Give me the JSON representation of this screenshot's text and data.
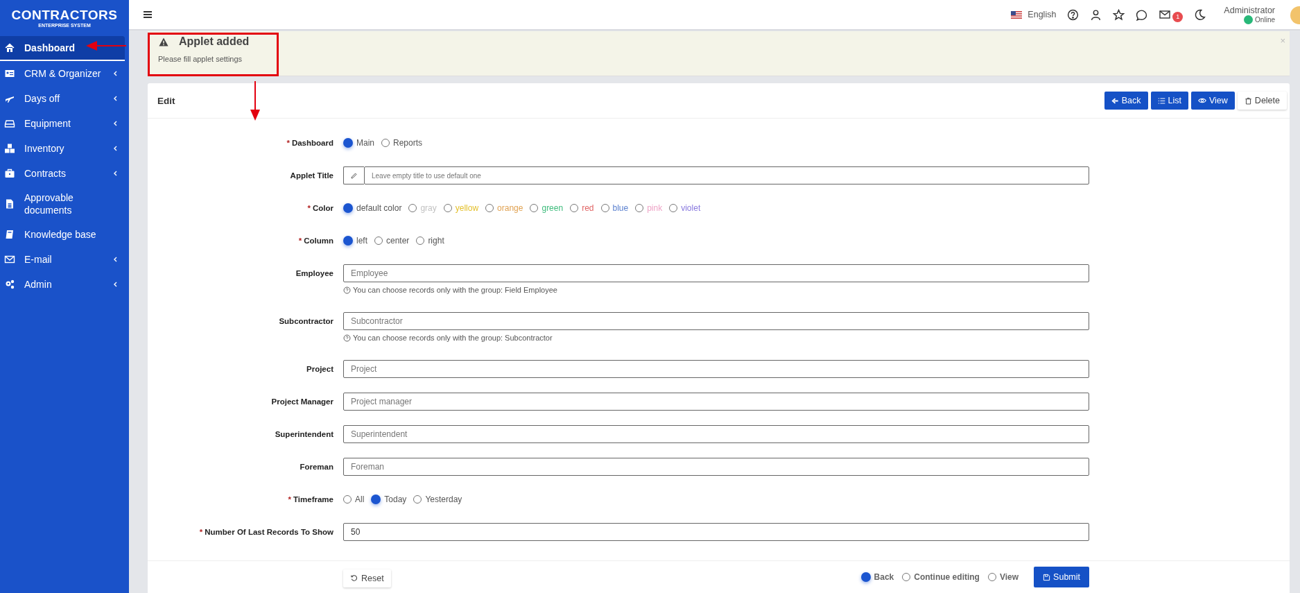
{
  "sidebar": {
    "logo": {
      "title": "CONTRACTORS",
      "subtitle": "ENTERPRISE SYSTEM"
    },
    "items": [
      {
        "label": "Dashboard",
        "selected": true,
        "submenu": false
      },
      {
        "label": "CRM & Organizer",
        "selected": false,
        "submenu": true
      },
      {
        "label": "Days off",
        "selected": false,
        "submenu": true
      },
      {
        "label": "Equipment",
        "selected": false,
        "submenu": true
      },
      {
        "label": "Inventory",
        "selected": false,
        "submenu": true
      },
      {
        "label": "Contracts",
        "selected": false,
        "submenu": true
      },
      {
        "label": "Approvable documents",
        "selected": false,
        "submenu": false
      },
      {
        "label": "Knowledge base",
        "selected": false,
        "submenu": false
      },
      {
        "label": "E-mail",
        "selected": false,
        "submenu": true
      },
      {
        "label": "Admin",
        "selected": false,
        "submenu": true
      }
    ]
  },
  "header": {
    "language": "English",
    "mail_badge": "1",
    "user": {
      "name": "Administrator",
      "status": "Online"
    }
  },
  "alert": {
    "title": "Applet added",
    "message": "Please fill applet settings",
    "close": "×"
  },
  "card": {
    "title": "Edit",
    "actions": [
      {
        "label": "Back",
        "kind": "primary"
      },
      {
        "label": "List",
        "kind": "primary"
      },
      {
        "label": "View",
        "kind": "primary"
      },
      {
        "label": "Delete",
        "kind": "light"
      }
    ],
    "fields": [
      {
        "label": "Dashboard",
        "marker": "*",
        "kind": "radio",
        "options": [
          {
            "label": "Main",
            "selected": true
          },
          {
            "label": "Reports",
            "selected": false
          }
        ]
      },
      {
        "label": "Applet Title",
        "kind": "input",
        "prefix_icon": true,
        "placeholder": "Leave empty title to use default one"
      },
      {
        "label": "Color",
        "marker": "*",
        "kind": "radio",
        "options": [
          {
            "label": "default color",
            "selected": true,
            "color": "#555555"
          },
          {
            "label": "gray",
            "selected": false,
            "color": "#c2c2c2"
          },
          {
            "label": "yellow",
            "selected": false,
            "color": "#e3bf2a"
          },
          {
            "label": "orange",
            "selected": false,
            "color": "#e0a252"
          },
          {
            "label": "green",
            "selected": false,
            "color": "#3dbb7b"
          },
          {
            "label": "red",
            "selected": false,
            "color": "#e06464"
          },
          {
            "label": "blue",
            "selected": false,
            "color": "#5b80cf"
          },
          {
            "label": "pink",
            "selected": false,
            "color": "#eea3c6"
          },
          {
            "label": "violet",
            "selected": false,
            "color": "#8878de"
          }
        ]
      },
      {
        "label": "Column",
        "marker": "*",
        "kind": "radio",
        "options": [
          {
            "label": "left",
            "selected": true
          },
          {
            "label": "center",
            "selected": false
          },
          {
            "label": "right",
            "selected": false
          }
        ]
      },
      {
        "label": "Employee",
        "kind": "input",
        "placeholder": "Employee",
        "hint": "You can choose records only with the group: Field Employee"
      },
      {
        "label": "Subcontractor",
        "kind": "input",
        "placeholder": "Subcontractor",
        "hint": "You can choose records only with the group: Subcontractor"
      },
      {
        "label": "Project",
        "kind": "input",
        "placeholder": "Project"
      },
      {
        "label": "Project Manager",
        "kind": "input",
        "placeholder": "Project manager"
      },
      {
        "label": "Superintendent",
        "kind": "input",
        "placeholder": "Superintendent"
      },
      {
        "label": "Foreman",
        "kind": "input",
        "placeholder": "Foreman"
      },
      {
        "label": "Timeframe",
        "marker": "*",
        "kind": "radio",
        "options": [
          {
            "label": "All",
            "selected": false
          },
          {
            "label": "Today",
            "selected": true
          },
          {
            "label": "Yesterday",
            "selected": false
          }
        ]
      },
      {
        "label": "Number Of Last Records To Show",
        "marker": "*",
        "kind": "input",
        "value": "50"
      }
    ],
    "footer": {
      "reset": "Reset",
      "after_save": [
        {
          "label": "Back",
          "selected": true
        },
        {
          "label": "Continue editing",
          "selected": false
        },
        {
          "label": "View",
          "selected": false
        }
      ],
      "submit": "Submit"
    }
  }
}
